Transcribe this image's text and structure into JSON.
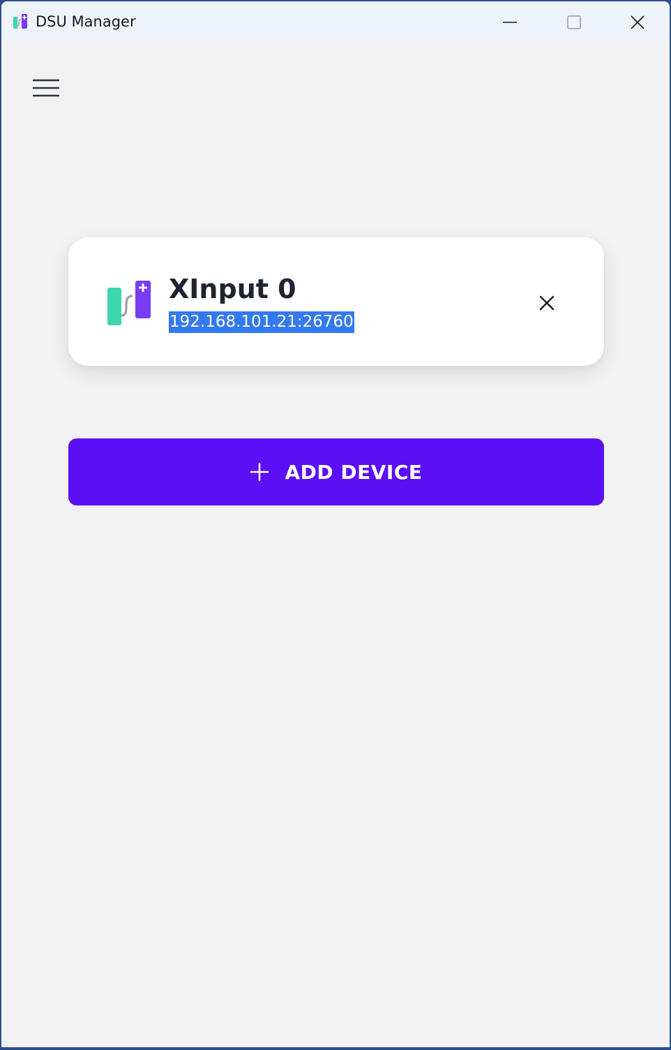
{
  "window": {
    "title": "DSU Manager"
  },
  "menu": {
    "icon": "hamburger-menu-icon"
  },
  "devices": [
    {
      "name": "XInput 0",
      "address": "192.168.101.21:26760",
      "icon": "controller-app-icon"
    }
  ],
  "actions": {
    "add_device_label": "ADD DEVICE"
  },
  "colors": {
    "accent": "#5a0ff5",
    "selection": "#3379f0",
    "background": "#f2f2f2",
    "card": "#ffffff",
    "icon_green": "#3cd6b0",
    "icon_purple": "#7a3cf6"
  }
}
